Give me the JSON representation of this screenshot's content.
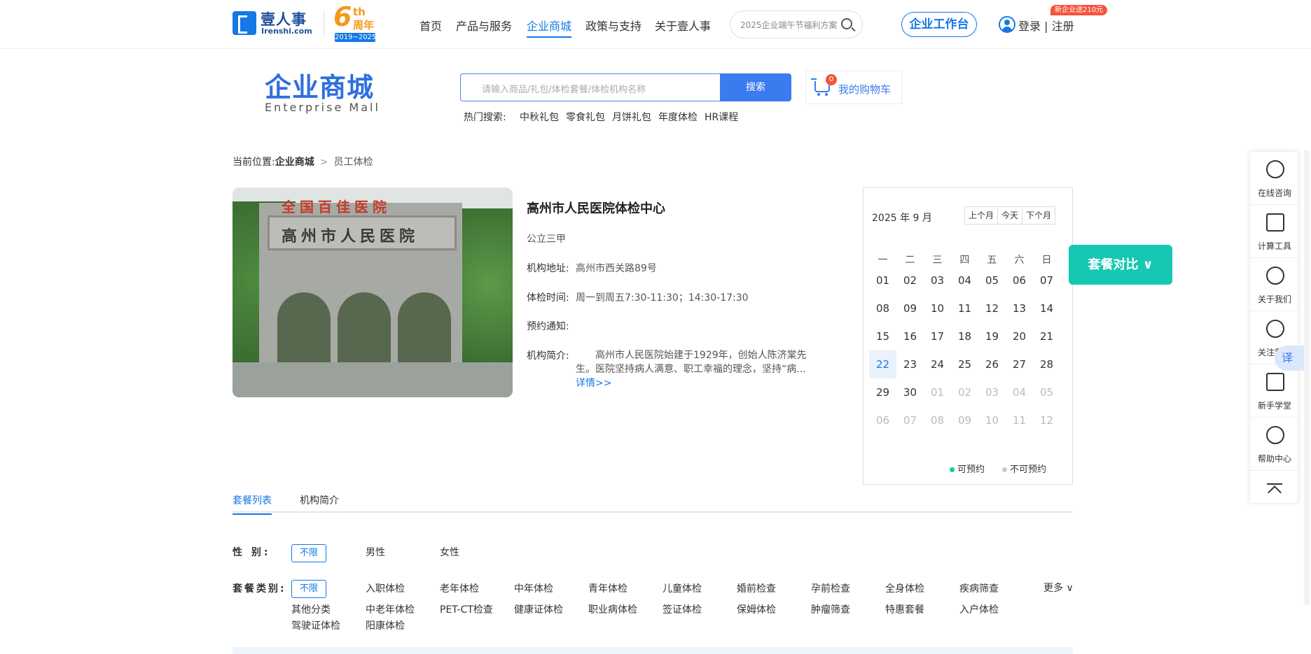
{
  "header": {
    "logo_cn": "壹人事",
    "logo_en": "Irenshi.com",
    "anniversary_num": "6",
    "anniversary_th": "th",
    "anniversary_zh": "周年",
    "anniversary_years": "2019~2025",
    "nav": [
      "首页",
      "产品与服务",
      "企业商城",
      "政策与支持",
      "关于壹人事"
    ],
    "active_nav": "企业商城",
    "search_text": "2025企业端午节福利方案",
    "workbench_label": "企业工作台",
    "login_label": "登录 | 注册",
    "promo_badge": "新企业送210元"
  },
  "mall": {
    "title": "企业商城",
    "subtitle": "Enterprise  Mall",
    "search_placeholder": "请输入商品/礼包/体检套餐/体检机构名称",
    "search_button": "搜索",
    "cart_count": "0",
    "cart_label": "我的购物车",
    "hot_label": "热门搜索:",
    "hot_items": [
      "中秋礼包",
      "零食礼包",
      "月饼礼包",
      "年度体检",
      "HR课程"
    ]
  },
  "breadcrumb": {
    "prefix": "当前位置:",
    "current": "企业商城",
    "separator": ">",
    "leaf": "员工体检"
  },
  "institution": {
    "photo_red_text": "全国百佳医院",
    "photo_gate_text": "高州市人民医院",
    "name": "高州市人民医院体检中心",
    "grade": "公立三甲",
    "address_label": "机构地址:",
    "address": "高州市西关路89号",
    "hours_label": "体检时间:",
    "hours": "周一到周五7:30-11:30；14:30-17:30",
    "notice_label": "预约通知:",
    "intro_label": "机构简介:",
    "intro": "高州市人民医院始建于1929年，创始人陈济棠先生。医院坚持病人满意、职工幸福的理念，坚持“病...",
    "detail_link": "详情>>"
  },
  "calendar": {
    "title": "2025 年 9 月",
    "buttons": [
      "上个月",
      "今天",
      "下个月"
    ],
    "weekdays": [
      "一",
      "二",
      "三",
      "四",
      "五",
      "六",
      "日"
    ],
    "days": [
      "01",
      "02",
      "03",
      "04",
      "05",
      "06",
      "07",
      "08",
      "09",
      "10",
      "11",
      "12",
      "13",
      "14",
      "15",
      "16",
      "17",
      "18",
      "19",
      "20",
      "21",
      "22",
      "23",
      "24",
      "25",
      "26",
      "27",
      "28",
      "29",
      "30",
      "01",
      "02",
      "03",
      "04",
      "05",
      "06",
      "07",
      "08",
      "09",
      "10",
      "11",
      "12"
    ],
    "today": "22",
    "legend_available": "可预约",
    "legend_unavailable": "不可预约",
    "available_color": "#16c7a3",
    "unavailable_color": "#cccccc"
  },
  "compare_button": "套餐对比",
  "sidebar": [
    "在线咨询",
    "计算工具",
    "关于我们",
    "关注我们",
    "新手学堂",
    "帮助中心"
  ],
  "translate_label": "译",
  "tabs": [
    "套餐列表",
    "机构简介"
  ],
  "filters": {
    "gender_label": "性    别:",
    "gender_selected": "不限",
    "gender_options": [
      "男性",
      "女性"
    ],
    "type_label": "套餐类别:",
    "type_selected": "不限",
    "type_row1": [
      "入职体检",
      "老年体检",
      "中年体检",
      "青年体检",
      "儿童体检",
      "婚前检查",
      "孕前检查",
      "全身体检",
      "疾病筛查"
    ],
    "type_row2": [
      "其他分类",
      "中老年体检",
      "PET-CT检查",
      "健康证体检",
      "职业病体检",
      "签证体检",
      "保姆体检",
      "肿瘤筛查",
      "特惠套餐",
      "入户体检"
    ],
    "type_row3": [
      "驾驶证体检",
      "阳康体检"
    ],
    "more": "更多"
  },
  "colors": {
    "accent": "#1677e6",
    "teal": "#16c7b3"
  }
}
